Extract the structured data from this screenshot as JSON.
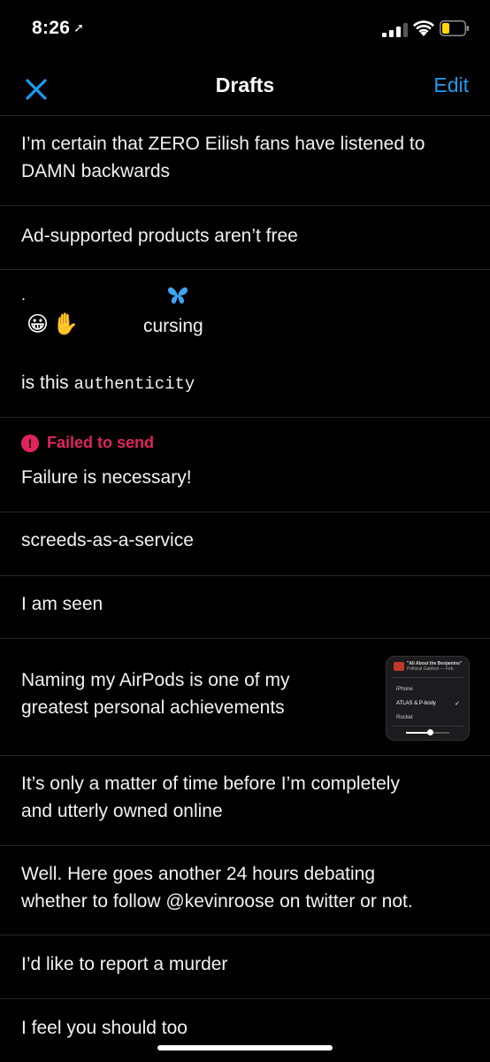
{
  "status": {
    "time": "8:26",
    "location_glyph": "➚"
  },
  "nav": {
    "title": "Drafts",
    "edit_label": "Edit"
  },
  "drafts": [
    {
      "line1": "I’m certain that ZERO Eilish fans have listened to",
      "line2": "DAMN backwards"
    },
    {
      "text": "Ad-supported products aren’t free"
    },
    {
      "dot": ".",
      "emoji1": "😀",
      "emoji2": "✋",
      "butterfly": "🦋",
      "cursing": "cursing",
      "prefix": "is this ",
      "mono_word": "authenticity"
    },
    {
      "failed_label": "Failed to send",
      "text": "Failure is necessary!"
    },
    {
      "text": "screeds-as-a-service"
    },
    {
      "text": "I am seen"
    },
    {
      "line1": "Naming my AirPods is one of my",
      "line2": "greatest personal achievements",
      "thumb": {
        "header1": "\"All About the Benjamins\"",
        "header2": "Political Gabfest — Feb",
        "row1": "iPhone",
        "row2": "ATLAS & P-body",
        "row3": "Rocket"
      }
    },
    {
      "line1": "It’s only a matter of time before I’m completely",
      "line2": "and utterly owned online"
    },
    {
      "line1": "Well. Here goes another 24 hours debating",
      "line2": "whether to follow @kevinroose on twitter or not."
    },
    {
      "text": "I’d like to report a murder"
    },
    {
      "text": "I feel you should too"
    }
  ],
  "colors": {
    "accent": "#1d9bf0",
    "error": "#e0245e",
    "battery": "#ffd60a"
  }
}
